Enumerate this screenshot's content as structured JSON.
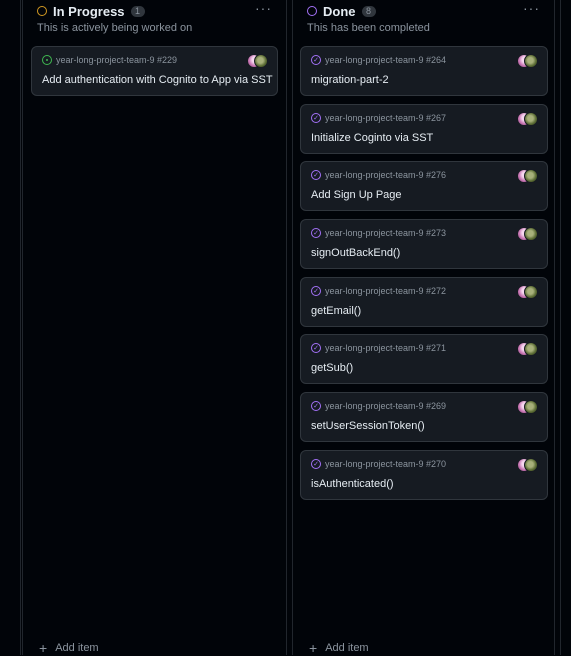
{
  "columns": [
    {
      "title": "In Progress",
      "count": "1",
      "description": "This is actively being worked on",
      "status_color": "#d29922",
      "more_label": "···",
      "cards": [
        {
          "meta": "year-long-project-team-9 #229",
          "title": "Add authentication with Cognito to App via SST",
          "state": "open"
        }
      ],
      "add_label": "Add item"
    },
    {
      "title": "Done",
      "count": "8",
      "description": "This has been completed",
      "status_color": "#a371f7",
      "more_label": "···",
      "cards": [
        {
          "meta": "year-long-project-team-9 #264",
          "title": "migration-part-2",
          "state": "done"
        },
        {
          "meta": "year-long-project-team-9 #267",
          "title": "Initialize Coginto via SST",
          "state": "done"
        },
        {
          "meta": "year-long-project-team-9 #276",
          "title": "Add Sign Up Page",
          "state": "done"
        },
        {
          "meta": "year-long-project-team-9 #273",
          "title": "signOutBackEnd()",
          "state": "done"
        },
        {
          "meta": "year-long-project-team-9 #272",
          "title": "getEmail()",
          "state": "done"
        },
        {
          "meta": "year-long-project-team-9 #271",
          "title": "getSub()",
          "state": "done"
        },
        {
          "meta": "year-long-project-team-9 #269",
          "title": "setUserSessionToken()",
          "state": "done"
        },
        {
          "meta": "year-long-project-team-9 #270",
          "title": "isAuthenticated()",
          "state": "done"
        }
      ],
      "add_label": "Add item"
    }
  ]
}
